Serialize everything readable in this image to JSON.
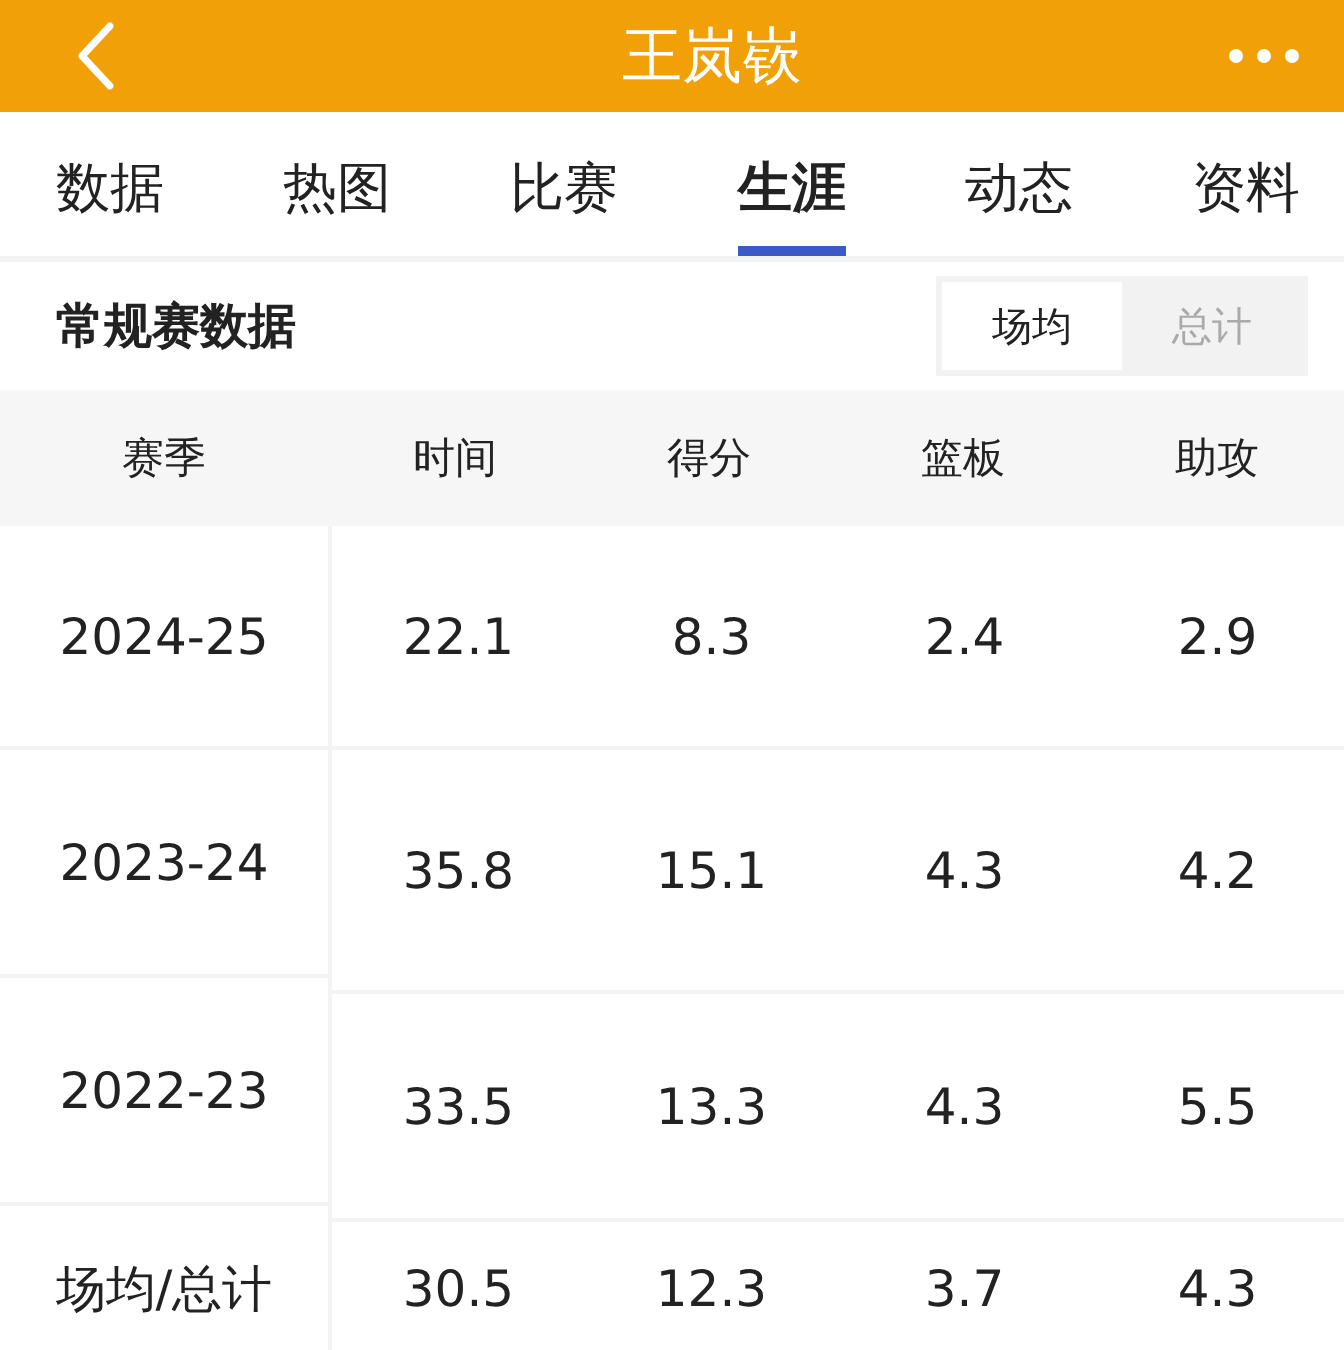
{
  "header": {
    "title": "王岚嵚"
  },
  "tabs": [
    {
      "label": "数据",
      "selected": false
    },
    {
      "label": "热图",
      "selected": false
    },
    {
      "label": "比赛",
      "selected": false
    },
    {
      "label": "生涯",
      "selected": true
    },
    {
      "label": "动态",
      "selected": false
    },
    {
      "label": "资料",
      "selected": false
    }
  ],
  "section": {
    "title": "常规赛数据",
    "toggle": [
      {
        "label": "场均",
        "selected": true
      },
      {
        "label": "总计",
        "selected": false
      }
    ]
  },
  "table": {
    "columns": [
      "赛季",
      "时间",
      "得分",
      "篮板",
      "助攻"
    ],
    "rows": [
      [
        "2024-25",
        "22.1",
        "8.3",
        "2.4",
        "2.9"
      ],
      [
        "2023-24",
        "35.8",
        "15.1",
        "4.3",
        "4.2"
      ],
      [
        "2022-23",
        "33.5",
        "13.3",
        "4.3",
        "5.5"
      ],
      [
        "场均/总计",
        "30.5",
        "12.3",
        "3.7",
        "4.3"
      ]
    ]
  }
}
